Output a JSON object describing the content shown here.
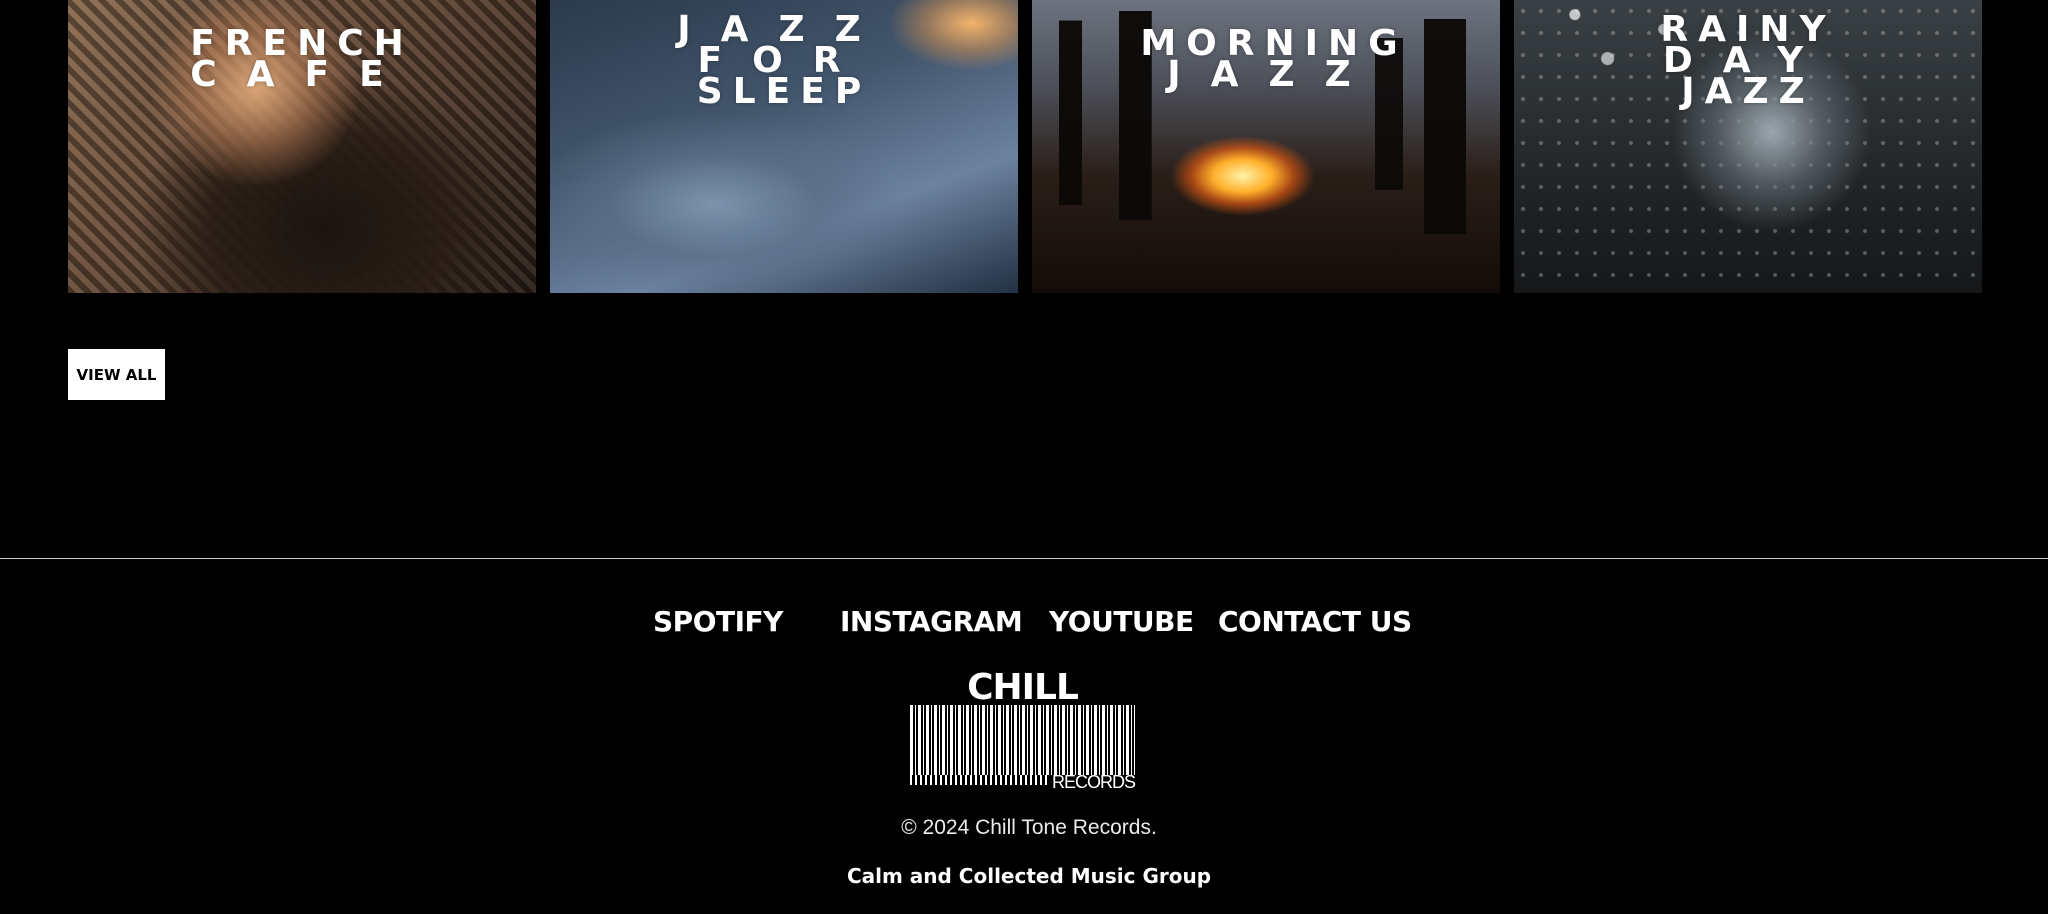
{
  "playlists": [
    {
      "lines": [
        "FRENCH",
        "CAFE"
      ]
    },
    {
      "lines": [
        "JAZZ",
        "FOR",
        "SLEEP"
      ]
    },
    {
      "lines": [
        "MORNING",
        "JAZZ"
      ]
    },
    {
      "lines": [
        "RAINY",
        "DAY",
        "JAZZ"
      ]
    }
  ],
  "view_all_label": "VIEW ALL",
  "footer": {
    "links": [
      "SPOTIFY",
      "INSTAGRAM",
      "YOUTUBE",
      "CONTACT US"
    ],
    "logo_name": "CHILL TONE",
    "logo_sub": "RECORDS",
    "copyright": "© 2024 Chill Tone Records.",
    "tagline": "Calm and Collected Music Group"
  }
}
